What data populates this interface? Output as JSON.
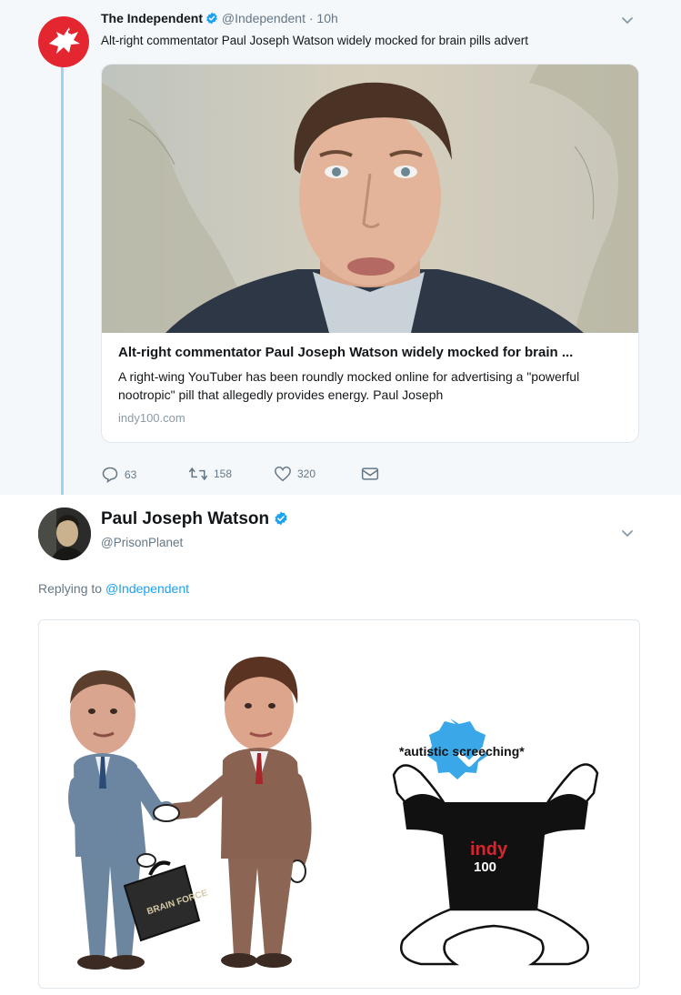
{
  "tweet1": {
    "author_name": "The Independent",
    "handle": "@Independent",
    "separator": "·",
    "time": "10h",
    "text": "Alt-right commentator Paul Joseph Watson widely mocked for brain pills advert",
    "card": {
      "title": "Alt-right commentator Paul Joseph Watson widely mocked for brain ...",
      "description": "A right-wing YouTuber has been roundly mocked online for advertising a \"powerful nootropic\" pill that allegedly provides energy.  Paul Joseph",
      "domain": "indy100.com"
    },
    "actions": {
      "replies": "63",
      "retweets": "158",
      "likes": "320"
    }
  },
  "tweet2": {
    "author_name": "Paul Joseph Watson",
    "handle": "@PrisonPlanet",
    "replying_prefix": "Replying to",
    "replying_to": "@Independent",
    "meme": {
      "caption": "*autistic screeching*",
      "briefcase_text": "BRAIN FORCE",
      "shirt_text_top": "indy",
      "shirt_text_bottom": "100"
    }
  },
  "colors": {
    "twitter_blue": "#1da1f2",
    "independent_red": "#e3262f",
    "thread_line": "#9fd2f2"
  },
  "icons": [
    "eagle-logo-icon",
    "verified-badge-icon",
    "chevron-down-icon",
    "reply-icon",
    "retweet-icon",
    "like-icon",
    "direct-message-icon"
  ]
}
